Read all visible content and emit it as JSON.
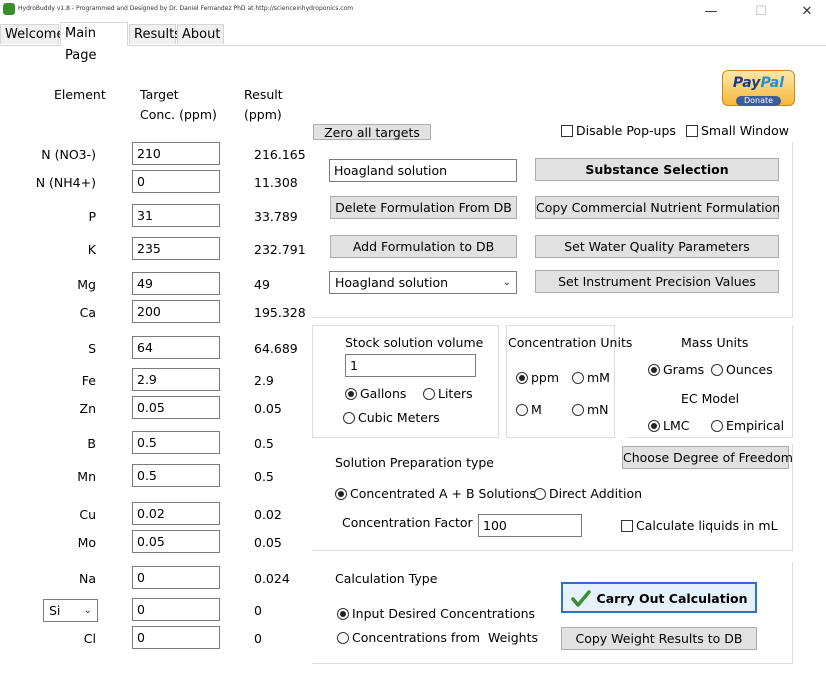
{
  "window": {
    "title": "HydroBuddy v1.8 - Programmed and Designed by Dr. Daniel Fernandez PhD at http://scienceinhydroponics.com",
    "minimize": "—",
    "maximize": "☐",
    "close": "✕"
  },
  "tabs": [
    {
      "label": "Welcome"
    },
    {
      "label": "Main Page"
    },
    {
      "label": "Results"
    },
    {
      "label": "About"
    }
  ],
  "table": {
    "header_element": "Element",
    "header_target_1": "Target",
    "header_target_2": "Conc. (ppm)",
    "header_result_1": "Result",
    "header_result_2": "(ppm)",
    "rows": [
      {
        "element": "N (NO3-)",
        "target": "210",
        "result": "216.165"
      },
      {
        "element": "N (NH4+)",
        "target": "0",
        "result": "11.308"
      },
      {
        "element": "P",
        "target": "31",
        "result": "33.789"
      },
      {
        "element": "K",
        "target": "235",
        "result": "232.791"
      },
      {
        "element": "Mg",
        "target": "49",
        "result": "49"
      },
      {
        "element": "Ca",
        "target": "200",
        "result": "195.328"
      },
      {
        "element": "S",
        "target": "64",
        "result": "64.689"
      },
      {
        "element": "Fe",
        "target": "2.9",
        "result": "2.9"
      },
      {
        "element": "Zn",
        "target": "0.05",
        "result": "0.05"
      },
      {
        "element": "B",
        "target": "0.5",
        "result": "0.5"
      },
      {
        "element": "Mn",
        "target": "0.5",
        "result": "0.5"
      },
      {
        "element": "Cu",
        "target": "0.02",
        "result": "0.02"
      },
      {
        "element": "Mo",
        "target": "0.05",
        "result": "0.05"
      },
      {
        "element": "Na",
        "target": "0",
        "result": "0.024"
      },
      {
        "element": "Si",
        "target": "0",
        "result": "0"
      },
      {
        "element": "Cl",
        "target": "0",
        "result": "0"
      }
    ]
  },
  "top": {
    "zero_targets": "Zero all targets",
    "disable_popups": "Disable Pop-ups",
    "small_window": "Small Window",
    "paypal_logo_1": "Pay",
    "paypal_logo_2": "Pal",
    "paypal_donate": "Donate"
  },
  "formulation": {
    "name_value": "Hoagland solution",
    "substance_selection": "Substance Selection",
    "delete_formulation": "Delete Formulation From DB",
    "copy_commercial": "Copy Commercial Nutrient Formulation",
    "add_formulation": "Add Formulation to DB",
    "water_quality": "Set Water Quality Parameters",
    "combo_value": "Hoagland solution",
    "instrument_precision": "Set Instrument Precision Values"
  },
  "stock": {
    "title": "Stock solution volume",
    "value": "1",
    "gallons": "Gallons",
    "liters": "Liters",
    "cubic_meters": "Cubic Meters"
  },
  "conc_units": {
    "title": "Concentration Units",
    "ppm": "ppm",
    "mM": "mM",
    "M": "M",
    "mN": "mN"
  },
  "mass_units": {
    "title": "Mass Units",
    "grams": "Grams",
    "ounces": "Ounces",
    "ec_title": "EC Model",
    "lmc": "LMC",
    "empirical": "Empirical"
  },
  "prep": {
    "title": "Solution Preparation type",
    "degree_freedom": "Choose Degree of Freedom",
    "ab": "Concentrated A + B Solutions",
    "direct": "Direct Addition",
    "factor_label": "Concentration Factor",
    "factor_value": "100",
    "liquids_ml": "Calculate liquids in mL"
  },
  "calc": {
    "title": "Calculation Type",
    "carry_out": "Carry Out Calculation",
    "input_desired": "Input Desired Concentrations",
    "from_weights": "Concentrations from  Weights",
    "copy_weights": "Copy Weight Results to DB"
  }
}
